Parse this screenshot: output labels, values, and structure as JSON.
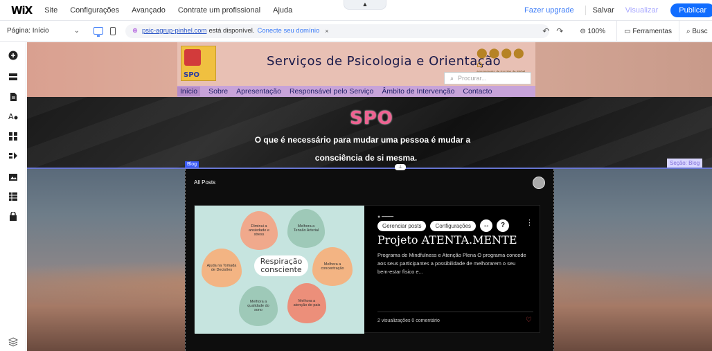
{
  "topbar": {
    "logo": "WiX",
    "menu": [
      "Site",
      "Configurações",
      "Avançado",
      "Contrate um profissional",
      "Ajuda"
    ],
    "handle": "▲",
    "upgrade": "Fazer upgrade",
    "save": "Salvar",
    "preview": "Visualizar",
    "publish": "Publicar"
  },
  "secondbar": {
    "page_label": "Página: Início",
    "url_link": "psic-agrup-pinhel.com",
    "url_text": "está disponível.",
    "connect": "Conecte seu domínio",
    "close": "×",
    "zoom": "100%",
    "tools": "Ferramentas",
    "search": "Busc"
  },
  "site": {
    "logo_text": "SPO",
    "title": "Serviços de Psicologia e Orientação",
    "agr_people": "⬤⬤⬤⬤ ⌂",
    "agr_sub": "Agrupamento de Escolas de Pinhel",
    "search_placeholder": "Procurar...",
    "nav": [
      "Início",
      "Sobre",
      "Apresentação",
      "Responsável pelo Serviço",
      "Âmbito de Intervenção",
      "Contacto"
    ]
  },
  "hero": {
    "logo": "SPO",
    "quote_line1": "O que é necessário para mudar uma pessoa é mudar a",
    "quote_line2": "consciência de si mesma."
  },
  "editor": {
    "blog_tag": "Blog",
    "section_tag": "Seção: Blog"
  },
  "blog": {
    "all_posts": "All Posts",
    "post": {
      "image_center": "Respiração consciente",
      "petals": [
        "Diminui a ansiedade e stress",
        "Melhora a Tensão Arterial",
        "Melhora a concentração",
        "Melhora a atenção de pais",
        "Melhora a qualidade do sono",
        "Ajuda na Tomada de Decisões"
      ],
      "btn_manage": "Gerenciar posts",
      "btn_settings": "Configurações",
      "title": "Projeto ATENTA.MENTE",
      "excerpt": "Programa de Mindfulness e Atenção Plena O programa concede aos seus participantes a possibilidade de melhorarem o seu bem-estar físico e...",
      "stats": "2 visualizações   0 comentário"
    }
  },
  "colors": {
    "publish": "#116dff",
    "accent": "#3b7bf7",
    "nav_bg": "#c7a3d9",
    "hero_logo": "#f06292"
  }
}
